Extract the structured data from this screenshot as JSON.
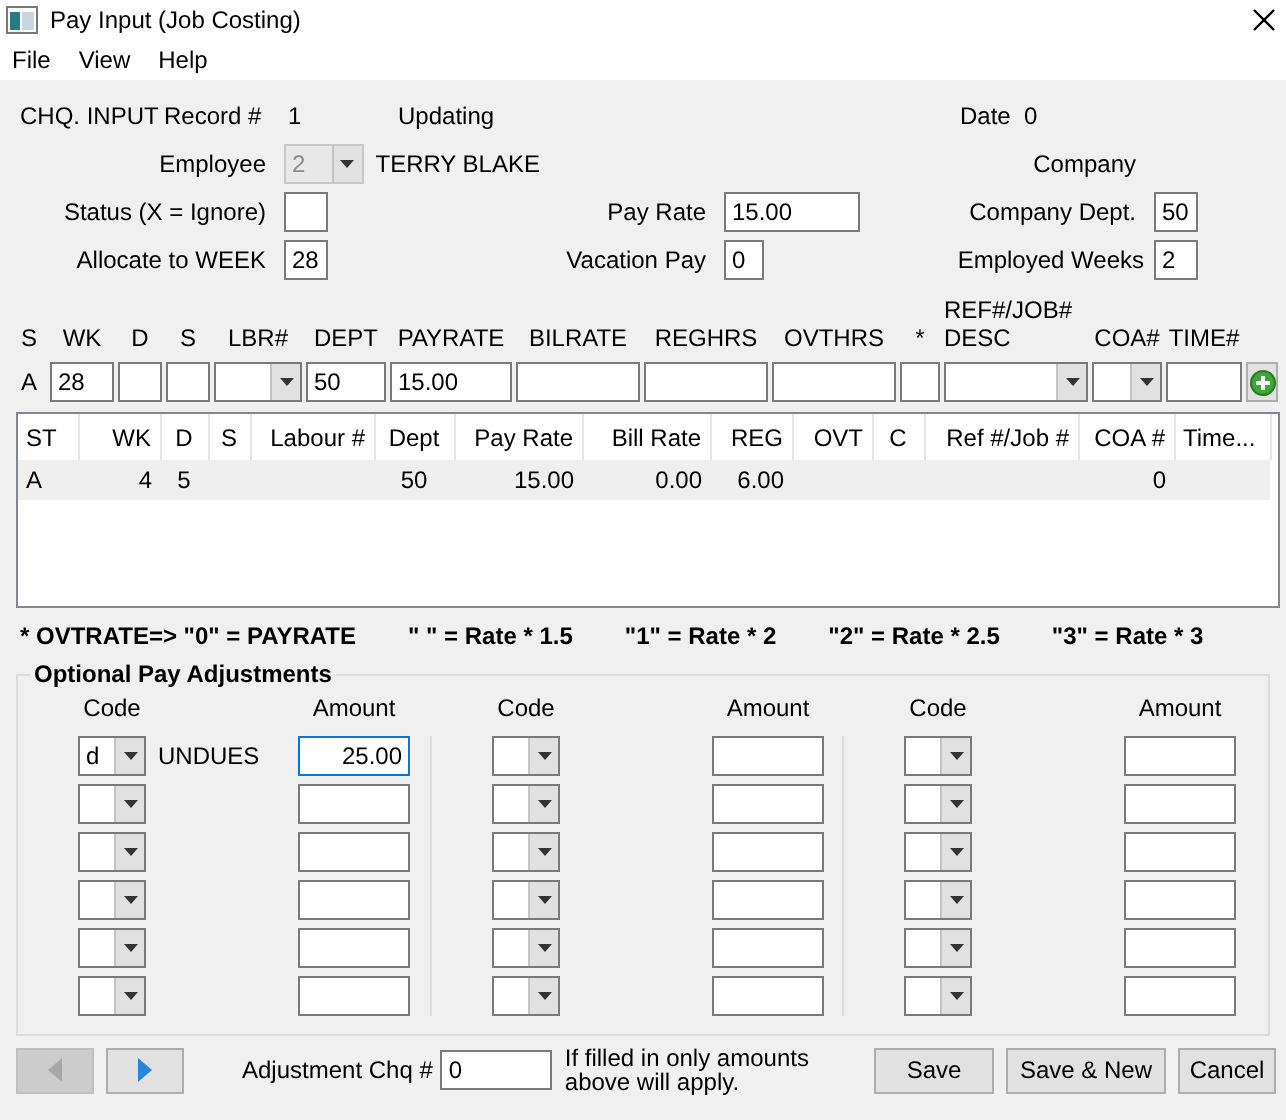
{
  "window": {
    "title": "Pay Input (Job Costing)"
  },
  "menu": [
    "File",
    "View",
    "Help"
  ],
  "header": {
    "form_label": "CHQ. INPUT",
    "record_label": "Record #",
    "record": "1",
    "mode": "Updating",
    "date_label": "Date",
    "date": "0",
    "employee_label": "Employee",
    "employee_id": "2",
    "employee_disabled": true,
    "employee_name": "TERRY BLAKE",
    "company_label": "Company",
    "status_label": "Status (X = Ignore)",
    "pay_rate_label": "Pay Rate",
    "pay_rate": "15.00",
    "company_dept_label": "Company Dept.",
    "company_dept": "50",
    "week_label": "Allocate to WEEK",
    "week": "28",
    "vacation_label": "Vacation Pay",
    "vacation": "0",
    "employed_weeks_label": "Employed Weeks",
    "employed_weeks": "2"
  },
  "entry": {
    "columns": [
      "S",
      "WK",
      "D",
      "S",
      "LBR#",
      "DEPT",
      "PAYRATE",
      "BILRATE",
      "REGHRS",
      "OVTHRS",
      "*",
      "REF#/JOB# DESC",
      "COA#",
      "TIME#"
    ],
    "fields": [
      {
        "kind": "label",
        "value": "A"
      },
      {
        "kind": "text",
        "value": "28"
      },
      {
        "kind": "text"
      },
      {
        "kind": "text"
      },
      {
        "kind": "combo"
      },
      {
        "kind": "text",
        "value": "50"
      },
      {
        "kind": "text",
        "value": "15.00"
      },
      {
        "kind": "text"
      },
      {
        "kind": "text"
      },
      {
        "kind": "text"
      },
      {
        "kind": "text"
      },
      {
        "kind": "combo"
      },
      {
        "kind": "combo"
      },
      {
        "kind": "text"
      }
    ]
  },
  "table": {
    "columns": [
      "ST",
      "WK",
      "D",
      "S",
      "Labour #",
      "Dept",
      "Pay Rate",
      "Bill Rate",
      "REG",
      "OVT",
      "C",
      "Ref #/Job #",
      "COA #",
      "Time..."
    ],
    "rows": [
      {
        "selected": true,
        "cells": {
          "0": "A",
          "1": "4",
          "2": "5",
          "5": "50",
          "6": "15.00",
          "7": "0.00",
          "8": "6.00",
          "12": "0"
        }
      }
    ]
  },
  "legend": [
    "* OVTRATE=> \"0\" = PAYRATE",
    "\" \" = Rate * 1.5",
    "\"1\" = Rate * 2",
    "\"2\" = Rate * 2.5",
    "\"3\" = Rate * 3"
  ],
  "adjustments": {
    "title": "Optional Pay Adjustments",
    "groups": [
      {
        "code_label": "Code",
        "amount_label": "Amount",
        "rows": [
          {
            "code": "d",
            "description": "UNDUES",
            "amount": "25.00",
            "focused": true
          },
          {
            "focused": false
          },
          {
            "focused": false
          },
          {
            "focused": false
          },
          {
            "focused": false
          },
          {
            "focused": false
          }
        ]
      },
      {
        "code_label": "Code",
        "amount_label": "Amount",
        "rows": [
          {
            "focused": false
          },
          {
            "focused": false
          },
          {
            "focused": false
          },
          {
            "focused": false
          },
          {
            "focused": false
          },
          {
            "focused": false
          }
        ]
      },
      {
        "code_label": "Code",
        "amount_label": "Amount",
        "rows": [
          {
            "focused": false
          },
          {
            "focused": false
          },
          {
            "focused": false
          },
          {
            "focused": false
          },
          {
            "focused": false
          },
          {
            "focused": false
          }
        ]
      }
    ]
  },
  "footer": {
    "prev_disabled": true,
    "next_disabled": false,
    "chq_label": "Adjustment Chq #",
    "chq": "0",
    "note": "If filled in only amounts above will apply.",
    "buttons": [
      "Save",
      "Save & New",
      "Cancel"
    ]
  }
}
